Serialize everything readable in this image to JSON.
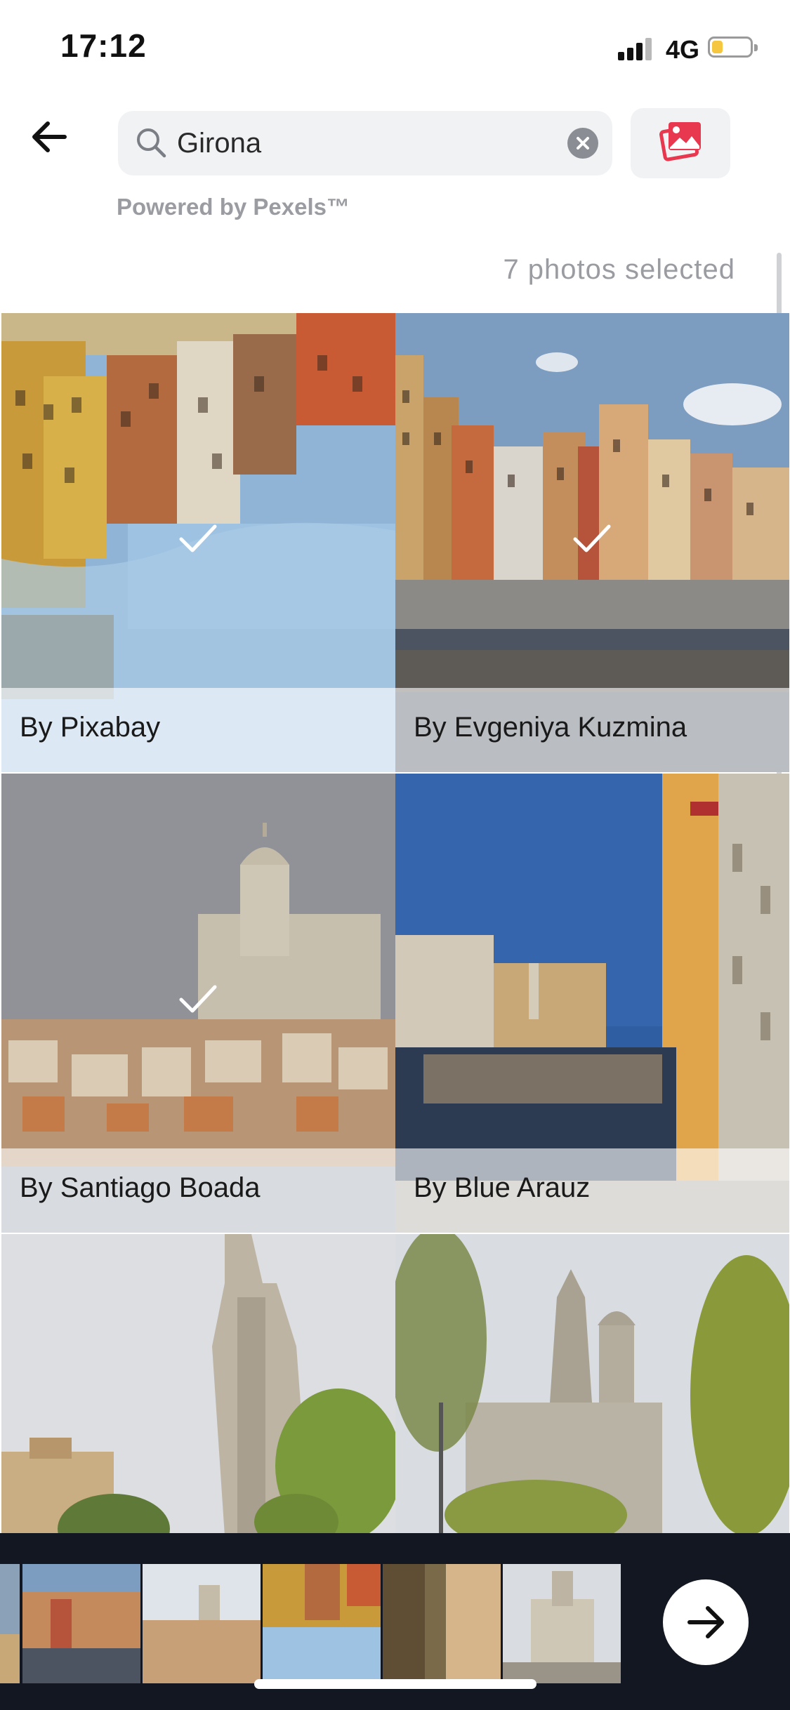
{
  "status_bar": {
    "time": "17:12",
    "network": "4G"
  },
  "header": {
    "back_icon": "arrow-left-icon",
    "search": {
      "value": "Girona",
      "placeholder": "Search"
    },
    "gallery_icon": "image-gallery-icon",
    "accent_color": "#e8384f"
  },
  "powered_by": "Powered by Pexels™",
  "selection": {
    "count_text": "7 photos selected"
  },
  "photos": [
    {
      "caption": "By Pixabay",
      "selected": true
    },
    {
      "caption": "By Evgeniya  Kuzmina",
      "selected": true
    },
    {
      "caption": "By Santiago  Boada",
      "selected": true
    },
    {
      "caption": "By Blue Arauz",
      "selected": false
    },
    {
      "caption": "",
      "selected": false
    },
    {
      "caption": "",
      "selected": false
    }
  ],
  "tray": {
    "next_icon": "arrow-right-icon",
    "thumbnail_count": 6
  }
}
